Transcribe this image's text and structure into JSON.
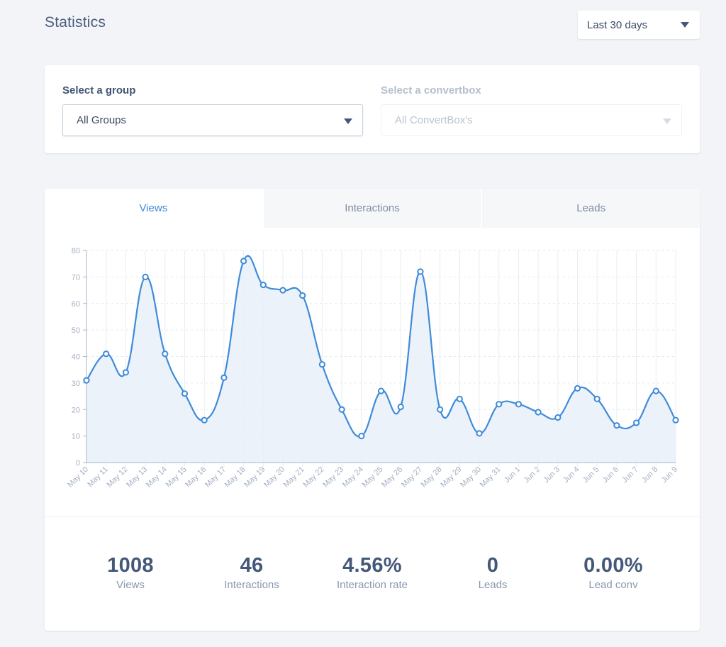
{
  "header": {
    "title": "Statistics",
    "range_select": {
      "value": "Last 30 days"
    }
  },
  "filters": {
    "group": {
      "label": "Select a group",
      "value": "All Groups"
    },
    "convertbox": {
      "label": "Select a convertbox",
      "placeholder": "All ConvertBox's",
      "disabled": true
    }
  },
  "tabs": [
    {
      "label": "Views",
      "active": true
    },
    {
      "label": "Interactions",
      "active": false
    },
    {
      "label": "Leads",
      "active": false
    }
  ],
  "colors": {
    "accent": "#3d8ad6",
    "line": "#3f8bd9",
    "area_fill": "#e9f1fa",
    "text_dark": "#44587a",
    "text_muted": "#8a98ad"
  },
  "chart_data": {
    "type": "area",
    "title": "",
    "xlabel": "",
    "ylabel": "",
    "ylim": [
      0,
      80
    ],
    "yticks": [
      0,
      10,
      20,
      30,
      40,
      50,
      60,
      70,
      80
    ],
    "grid": true,
    "legend": "none",
    "categories": [
      "May 10",
      "May 11",
      "May 12",
      "May 13",
      "May 14",
      "May 15",
      "May 16",
      "May 17",
      "May 18",
      "May 19",
      "May 20",
      "May 21",
      "May 22",
      "May 23",
      "May 24",
      "May 25",
      "May 26",
      "May 27",
      "May 28",
      "May 29",
      "May 30",
      "May 31",
      "Jun 1",
      "Jun 2",
      "Jun 3",
      "Jun 4",
      "Jun 5",
      "Jun 6",
      "Jun 7",
      "Jun 8",
      "Jun 9"
    ],
    "series": [
      {
        "name": "Views",
        "values": [
          31,
          41,
          34,
          70,
          41,
          26,
          16,
          32,
          76,
          67,
          65,
          63,
          37,
          20,
          10,
          27,
          21,
          72,
          20,
          24,
          11,
          22,
          22,
          19,
          17,
          28,
          24,
          14,
          15,
          27,
          16
        ]
      }
    ]
  },
  "stats": [
    {
      "value": "1008",
      "label": "Views"
    },
    {
      "value": "46",
      "label": "Interactions"
    },
    {
      "value": "4.56%",
      "label": "Interaction rate"
    },
    {
      "value": "0",
      "label": "Leads"
    },
    {
      "value": "0.00%",
      "label": "Lead conv"
    }
  ]
}
